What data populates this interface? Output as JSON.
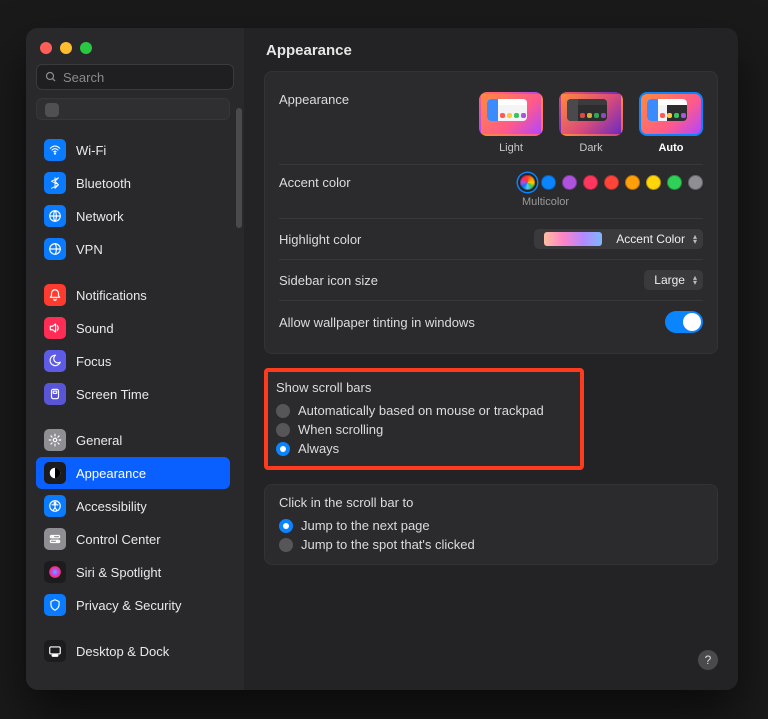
{
  "window": {
    "title": "Appearance"
  },
  "sidebar": {
    "search_placeholder": "Search",
    "groups": [
      {
        "items": [
          {
            "key": "wifi",
            "label": "Wi-Fi",
            "bg": "#0a7aff"
          },
          {
            "key": "bluetooth",
            "label": "Bluetooth",
            "bg": "#0a7aff"
          },
          {
            "key": "network",
            "label": "Network",
            "bg": "#0a7aff"
          },
          {
            "key": "vpn",
            "label": "VPN",
            "bg": "#0a7aff"
          }
        ]
      },
      {
        "items": [
          {
            "key": "notifications",
            "label": "Notifications",
            "bg": "#ff3b30"
          },
          {
            "key": "sound",
            "label": "Sound",
            "bg": "#ff2d55"
          },
          {
            "key": "focus",
            "label": "Focus",
            "bg": "#5e5ce6"
          },
          {
            "key": "screentime",
            "label": "Screen Time",
            "bg": "#5856d6"
          }
        ]
      },
      {
        "items": [
          {
            "key": "general",
            "label": "General",
            "bg": "#8e8e93"
          },
          {
            "key": "appearance",
            "label": "Appearance",
            "bg": "#1c1c1e",
            "selected": true
          },
          {
            "key": "accessibility",
            "label": "Accessibility",
            "bg": "#0a7aff"
          },
          {
            "key": "controlcenter",
            "label": "Control Center",
            "bg": "#8e8e93"
          },
          {
            "key": "siri",
            "label": "Siri & Spotlight",
            "bg": "#1c1c1e"
          },
          {
            "key": "privacy",
            "label": "Privacy & Security",
            "bg": "#0a7aff"
          }
        ]
      },
      {
        "items": [
          {
            "key": "desktopdock",
            "label": "Desktop & Dock",
            "bg": "#1c1c1e"
          }
        ]
      }
    ]
  },
  "main": {
    "appearance": {
      "label": "Appearance",
      "options": [
        {
          "key": "light",
          "label": "Light"
        },
        {
          "key": "dark",
          "label": "Dark"
        },
        {
          "key": "auto",
          "label": "Auto",
          "selected": true
        }
      ]
    },
    "accent": {
      "label": "Accent color",
      "selected_label": "Multicolor",
      "colors": [
        "multi",
        "#0a84ff",
        "#af52de",
        "#ff375f",
        "#ff453a",
        "#ff9f0a",
        "#ffd60a",
        "#30d158",
        "#8e8e93"
      ]
    },
    "highlight": {
      "label": "Highlight color",
      "value": "Accent Color"
    },
    "sidebar_icon": {
      "label": "Sidebar icon size",
      "value": "Large"
    },
    "wallpaper_tint": {
      "label": "Allow wallpaper tinting in windows",
      "on": true
    },
    "scrollbars": {
      "label": "Show scroll bars",
      "options": [
        {
          "label": "Automatically based on mouse or trackpad",
          "checked": false
        },
        {
          "label": "When scrolling",
          "checked": false
        },
        {
          "label": "Always",
          "checked": true
        }
      ]
    },
    "click_scroll": {
      "label": "Click in the scroll bar to",
      "options": [
        {
          "label": "Jump to the next page",
          "checked": true
        },
        {
          "label": "Jump to the spot that's clicked",
          "checked": false
        }
      ]
    },
    "help": "?"
  }
}
